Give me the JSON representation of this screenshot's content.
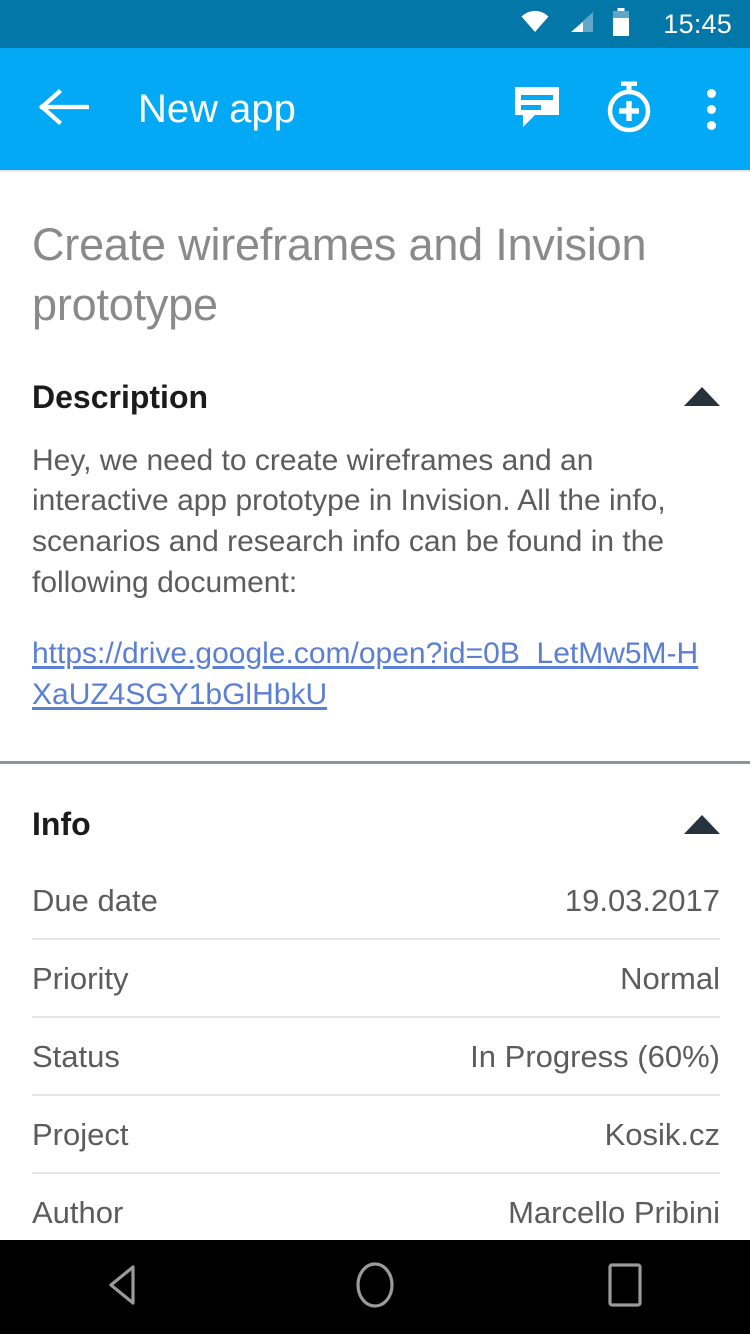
{
  "status_bar": {
    "time": "15:45",
    "icons": [
      "wifi-icon",
      "cellular-signal-icon",
      "battery-icon"
    ],
    "background_color": "#0277A8"
  },
  "app_bar": {
    "back_label": "back-arrow",
    "title": "New app",
    "background_color": "#03A9F4",
    "actions": [
      {
        "name": "comment-icon",
        "label": "Comments"
      },
      {
        "name": "timer-add-icon",
        "label": "Add time"
      },
      {
        "name": "overflow-menu-icon",
        "label": "More options"
      }
    ]
  },
  "task": {
    "title": "Create wireframes and Invision prototype",
    "title_color": "#8A8A8A"
  },
  "description_section": {
    "heading": "Description",
    "collapse_icon": "triangle-up-icon",
    "expanded": true,
    "body": "Hey, we need to create wireframes and an interactive app prototype in Invision. All the info, scenarios and research info can be found in the following document:",
    "link_text": "https://drive.google.com/open?id=0B_LetMw5M-HXaUZ4SGY1bGlHbkU",
    "link_color": "#5B7FD4"
  },
  "info_section": {
    "heading": "Info",
    "collapse_icon": "triangle-up-icon",
    "expanded": true,
    "rows": [
      {
        "label": "Due date",
        "value": "19.03.2017"
      },
      {
        "label": "Priority",
        "value": "Normal"
      },
      {
        "label": "Status",
        "value": "In Progress (60%)"
      },
      {
        "label": "Project",
        "value": "Kosik.cz"
      },
      {
        "label": "Author",
        "value": "Marcello Pribini"
      }
    ]
  },
  "nav_bar": {
    "buttons": [
      {
        "name": "android-back-button",
        "label": "Back"
      },
      {
        "name": "android-home-button",
        "label": "Home"
      },
      {
        "name": "android-recents-button",
        "label": "Recents"
      }
    ],
    "background_color": "#000000"
  }
}
